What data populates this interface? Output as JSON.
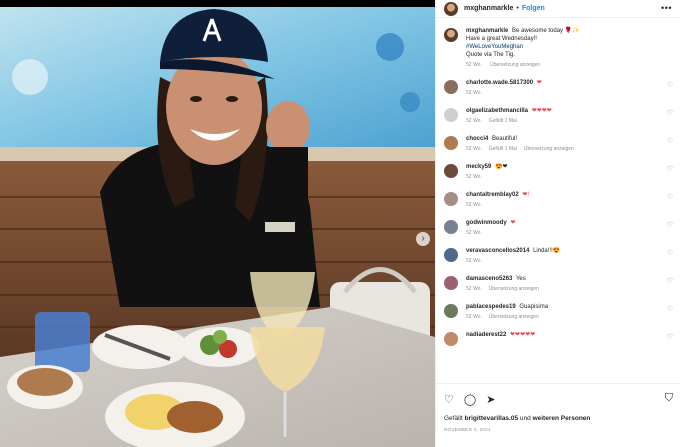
{
  "post": {
    "username": "mxghanmarkle",
    "follow_label": "Folgen",
    "more_label": "•••",
    "caption_user": "mxghanmarkle",
    "caption_lines": [
      "Be awesome today 🌹✨",
      "Have a great Wednesday!!",
      "#WeLoveYouMeghan",
      "Quote via The Tig."
    ],
    "caption_time": "52 Wo.",
    "caption_translate": "Übersetzung anzeigen"
  },
  "comments": [
    {
      "user": "charlotte.wade.5817300",
      "text": "❤",
      "time": "52 Wo.",
      "likes": "",
      "translate": "",
      "avatar_color": "#8b6f5e"
    },
    {
      "user": "olgaelizabethmancilla",
      "text": "❤❤❤❤",
      "time": "52 Wo.",
      "likes": "Gefällt 1 Mal",
      "translate": "",
      "avatar_color": "#cfcfcf"
    },
    {
      "user": "chocci4",
      "text": "Beautiful!",
      "time": "52 Wo.",
      "likes": "Gefällt 1 Mal",
      "translate": "Übersetzung anzeigen",
      "avatar_color": "#b07a4f"
    },
    {
      "user": "mecky59",
      "text": "😍❤",
      "time": "52 Wo.",
      "likes": "",
      "translate": "",
      "avatar_color": "#6e4a3a"
    },
    {
      "user": "chantaltremblay02",
      "text": "❤!",
      "time": "52 Wo.",
      "likes": "",
      "translate": "",
      "avatar_color": "#a48e86"
    },
    {
      "user": "godwinmoody",
      "text": "❤",
      "time": "52 Wo.",
      "likes": "",
      "translate": "",
      "avatar_color": "#7a7f92"
    },
    {
      "user": "veravasconcellos2014",
      "text": "Linda!!!😍",
      "time": "52 Wo.",
      "likes": "",
      "translate": "",
      "avatar_color": "#4d6a86"
    },
    {
      "user": "damasceno5263",
      "text": "Yes",
      "time": "52 Wo.",
      "likes": "",
      "translate": "Übersetzung anzeigen",
      "avatar_color": "#9c5f78"
    },
    {
      "user": "pablacespedes19",
      "text": "Guapisima",
      "time": "52 Wo.",
      "likes": "",
      "translate": "Übersetzung anzeigen",
      "avatar_color": "#6a7a5a"
    },
    {
      "user": "nadiaderest22",
      "text": "❤❤❤❤❤",
      "time": "",
      "likes": "",
      "translate": "",
      "avatar_color": "#c08a6a"
    }
  ],
  "footer": {
    "likes_prefix": "Gefällt",
    "liked_by": "brigittevarillas.05",
    "likes_middle": "und",
    "likes_others": "weiteren Personen",
    "date": "NOVEMBER 3, 2021"
  },
  "icons": {
    "like": "heart-outline-icon",
    "comment": "comment-bubble-icon",
    "share": "paper-plane-icon",
    "save": "bookmark-icon",
    "next": "chevron-right-icon"
  },
  "colors": {
    "link": "#0095f6",
    "heart": "#ed4956",
    "meta": "#8e8e8e",
    "text": "#262626"
  }
}
